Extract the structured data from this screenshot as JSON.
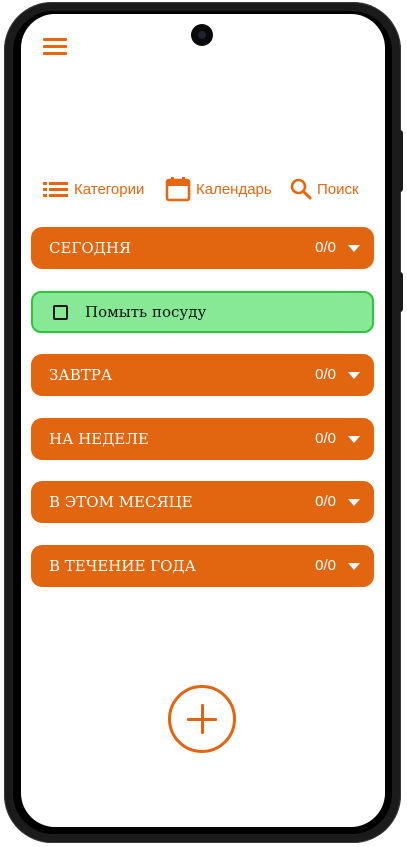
{
  "colors": {
    "accent": "#e2650f",
    "task_bg": "#87e895",
    "task_border": "#2dc43d"
  },
  "nav": {
    "categories": {
      "icon": "list-icon",
      "label": "Категории"
    },
    "calendar": {
      "icon": "calendar-icon",
      "label": "Календарь"
    },
    "search": {
      "icon": "search-icon",
      "label": "Поиск"
    }
  },
  "sections": [
    {
      "title": "СЕГОДНЯ",
      "count": "0/0",
      "expanded": true
    },
    {
      "title": "ЗАВТРА",
      "count": "0/0",
      "expanded": false
    },
    {
      "title": "НА НЕДЕЛЕ",
      "count": "0/0",
      "expanded": false
    },
    {
      "title": "В ЭТОМ МЕСЯЦЕ",
      "count": "0/0",
      "expanded": false
    },
    {
      "title": "В ТЕЧЕНИЕ ГОДА",
      "count": "0/0",
      "expanded": false
    }
  ],
  "today_tasks": [
    {
      "label": "Помыть посуду",
      "done": false
    }
  ],
  "icons": {
    "menu": "hamburger-menu-icon",
    "add": "plus-circle-icon",
    "collapse": "caret-down-icon"
  }
}
